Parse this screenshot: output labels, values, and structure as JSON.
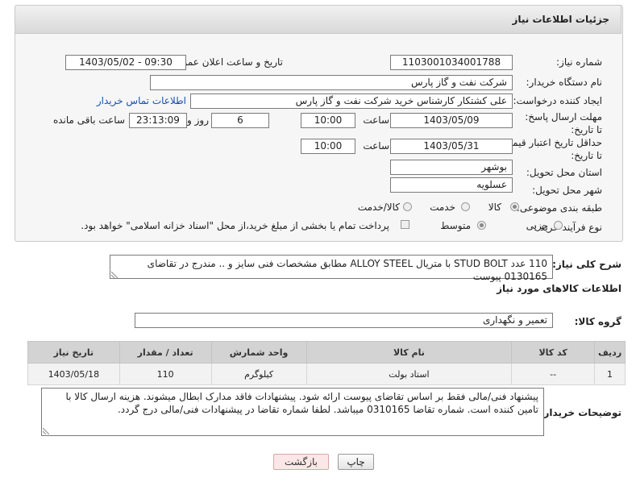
{
  "header": {
    "title": "جزئیات اطلاعات نیاز"
  },
  "form": {
    "need_number": {
      "label": "شماره نیاز:",
      "value": "1103001034001788"
    },
    "announce_datetime": {
      "label": "تاریخ و ساعت اعلان عمومی:",
      "value": "1403/05/02 - 09:30"
    },
    "buyer_org": {
      "label": "نام دستگاه خریدار:",
      "value": "شرکت نفت و گاز پارس"
    },
    "requester": {
      "label": "ایجاد کننده درخواست:",
      "value": "علی کشتکار کارشناس خرید شرکت نفت و گاز پارس",
      "contact_link": "اطلاعات تماس خریدار"
    },
    "deadline": {
      "label": "مهلت ارسال پاسخ: تا تاریخ:",
      "date": "1403/05/09",
      "time_label": "ساعت",
      "time": "10:00",
      "days": "6",
      "days_label": "روز و",
      "remaining": "23:13:09",
      "remaining_label": "ساعت باقی مانده"
    },
    "min_validity": {
      "label": "حداقل تاریخ اعتبار قیمت: تا تاریخ:",
      "date": "1403/05/31",
      "time_label": "ساعت",
      "time": "10:00"
    },
    "province": {
      "label": "استان محل تحویل:",
      "value": "بوشهر"
    },
    "city": {
      "label": "شهر محل تحویل:",
      "value": "عسلویه"
    },
    "category": {
      "label": "طبقه بندی موضوعی:",
      "options": [
        "کالا",
        "خدمت",
        "کالا/خدمت"
      ],
      "selected": "کالا"
    },
    "process": {
      "label": "نوع فرآیند خرید :",
      "options": [
        "جزیی",
        "متوسط"
      ],
      "selected": "متوسط",
      "payment_note": "پرداخت تمام یا بخشی از مبلغ خرید،از محل \"اسناد خزانه اسلامی\" خواهد بود."
    }
  },
  "summary": {
    "label": "شرح کلی نیاز:",
    "text": "110 عدد STUD BOLT با متریال ALLOY STEEL مطابق مشخصات فنی سایز و .. مندرج در تقاضای 0130165 پیوست"
  },
  "goods": {
    "section_title": "اطلاعات کالاهای مورد نیاز",
    "group_label": "گروه کالا:",
    "group_value": "تعمیر و نگهداری",
    "columns": [
      "ردیف",
      "کد کالا",
      "نام کالا",
      "واحد شمارش",
      "تعداد / مقدار",
      "تاریخ نیاز"
    ],
    "rows": [
      {
        "row": "1",
        "code": "--",
        "name": "استاد بولت",
        "unit": "کیلوگرم",
        "qty": "110",
        "date": "1403/05/18"
      }
    ]
  },
  "buyer_notes": {
    "label": "توضیحات خریدار:",
    "text": "پیشنهاد فنی/مالی فقط بر اساس تقاضای پیوست ارائه شود. پیشنهادات فاقد مدارک ابطال میشوند. هزینه ارسال کالا با تامین کننده است. شماره تقاضا 0310165  میباشد. لطفا شماره تقاضا در پیشنهادات فنی/مالی درج گردد."
  },
  "buttons": {
    "print": "چاپ",
    "back": "بازگشت"
  }
}
